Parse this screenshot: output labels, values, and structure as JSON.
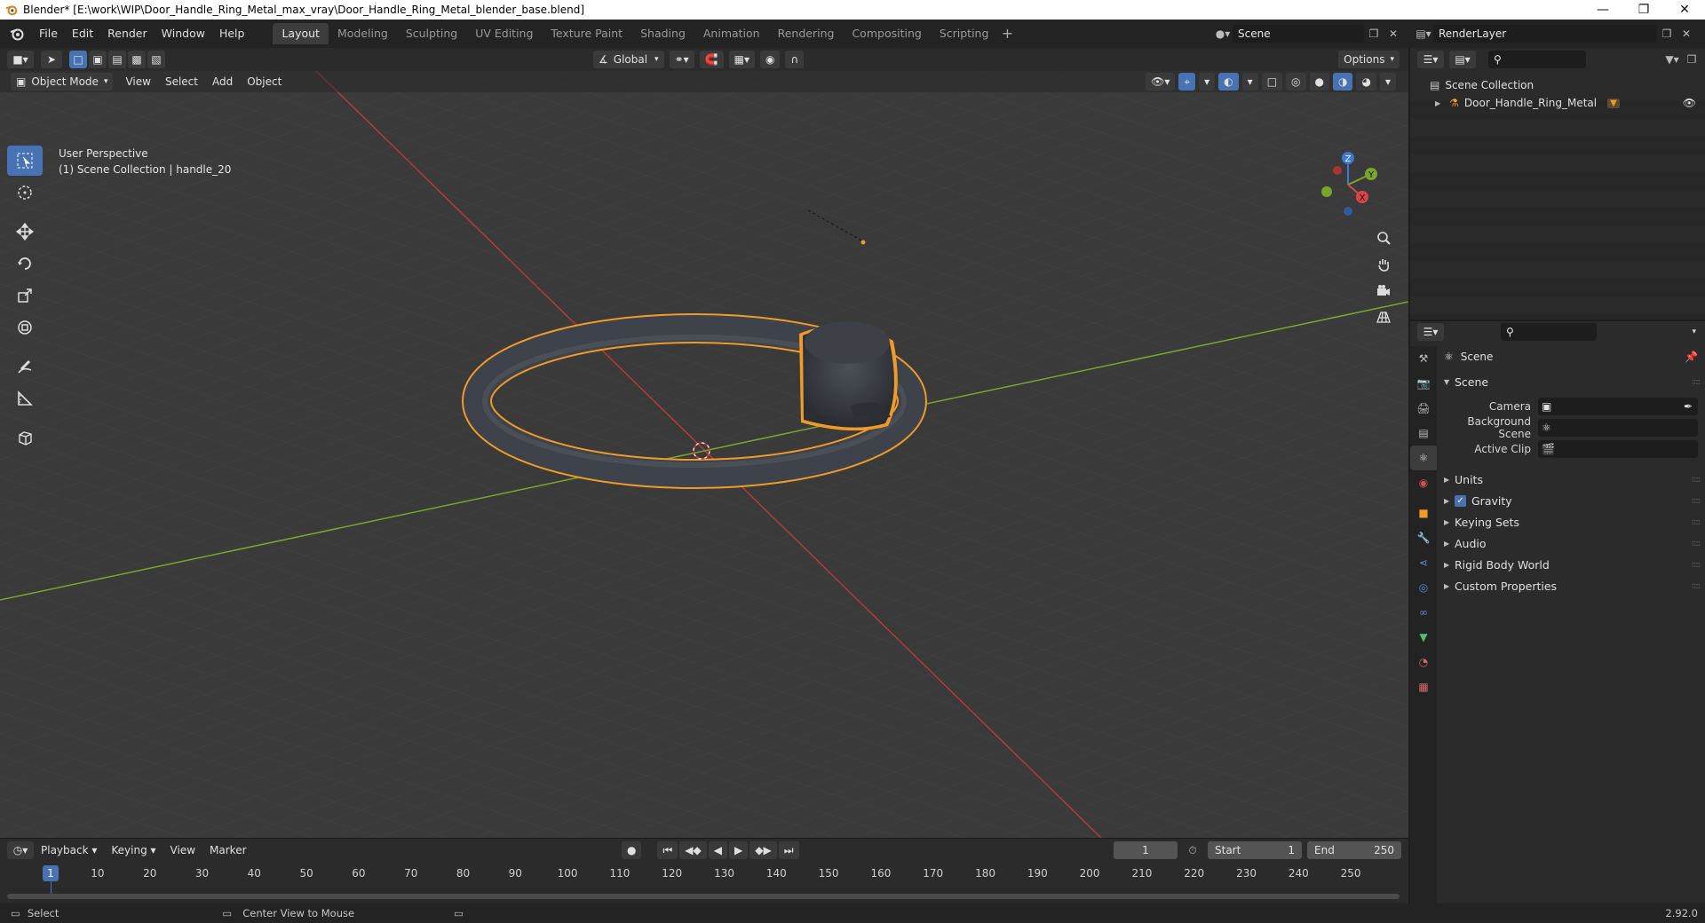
{
  "window": {
    "title": "Blender* [E:\\work\\WIP\\Door_Handle_Ring_Metal_max_vray\\Door_Handle_Ring_Metal_blender_base.blend]"
  },
  "menus": [
    "File",
    "Edit",
    "Render",
    "Window",
    "Help"
  ],
  "workspaces": [
    "Layout",
    "Modeling",
    "Sculpting",
    "UV Editing",
    "Texture Paint",
    "Shading",
    "Animation",
    "Rendering",
    "Compositing",
    "Scripting"
  ],
  "active_workspace": "Layout",
  "scene_name": "Scene",
  "view_layer": "RenderLayer",
  "viewport": {
    "mode": "Object Mode",
    "menus": [
      "View",
      "Select",
      "Add",
      "Object"
    ],
    "orientation": "Global",
    "options": "Options",
    "info_line1": "User Perspective",
    "info_line2": "(1) Scene Collection | handle_20",
    "gizmo": {
      "x": "X",
      "y": "Y",
      "z": "Z"
    }
  },
  "timeline": {
    "menus": [
      "Playback",
      "Keying",
      "View",
      "Marker"
    ],
    "current_frame": "1",
    "start_label": "Start",
    "start": "1",
    "end_label": "End",
    "end": "250",
    "ruler_marks": [
      "1",
      "10",
      "20",
      "30",
      "40",
      "50",
      "60",
      "70",
      "80",
      "90",
      "100",
      "110",
      "120",
      "130",
      "140",
      "150",
      "160",
      "170",
      "180",
      "190",
      "200",
      "210",
      "220",
      "230",
      "240",
      "250"
    ]
  },
  "outliner": {
    "root": "Scene Collection",
    "object": "Door_Handle_Ring_Metal"
  },
  "properties": {
    "context": "Scene",
    "panel": "Scene",
    "fields": {
      "camera_label": "Camera",
      "background_label": "Background Scene",
      "clip_label": "Active Clip"
    },
    "panels": [
      "Units",
      "Gravity",
      "Keying Sets",
      "Audio",
      "Rigid Body World",
      "Custom Properties"
    ]
  },
  "statusbar": {
    "left": "Select",
    "middle": "Center View to Mouse",
    "version": "2.92.0"
  },
  "colors": {
    "accent": "#4772b3",
    "selection_outline": "#f09a2a",
    "x_axis": "#b33a3a",
    "y_axis": "#7aa52c"
  }
}
